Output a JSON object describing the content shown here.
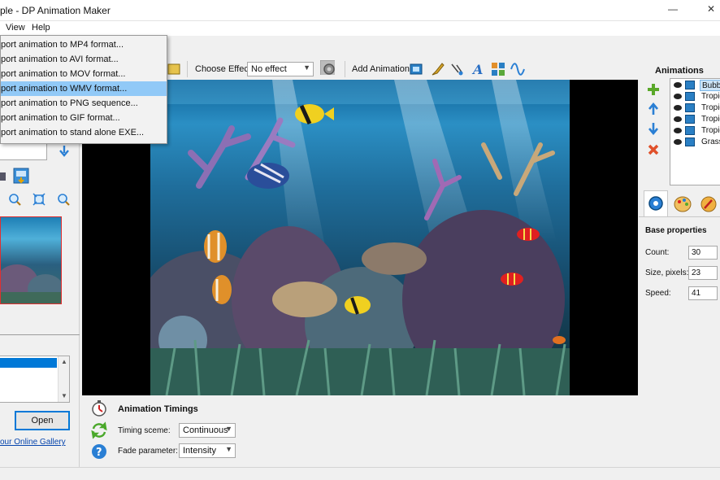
{
  "window": {
    "title": "ple - DP Animation Maker",
    "minimize": "—",
    "close": "✕"
  },
  "menu": {
    "items": [
      "View",
      "Help"
    ]
  },
  "export_menu": {
    "items": [
      "port animation to MP4 format...",
      "port animation to AVI format...",
      "port animation to MOV format...",
      "port animation to WMV format...",
      "port animation to PNG sequence...",
      "port animation to GIF format...",
      "port animation to stand alone EXE..."
    ],
    "selected_index": 3
  },
  "toolbar": {
    "choose_effect_label": "Choose Effect:",
    "effect_value": "No effect",
    "add_animation_label": "Add Animation"
  },
  "left": {
    "open_label": "Open",
    "gallery_link": "our Online Gallery"
  },
  "timing": {
    "title": "Animation Timings",
    "timing_scheme_label": "Timing sceme:",
    "timing_scheme_value": "Continuous",
    "fade_label": "Fade parameter:",
    "fade_value": "Intensity"
  },
  "animations": {
    "title": "Animations",
    "rows": [
      "Bubble",
      "Tropic",
      "Tropic",
      "Tropic",
      "Tropic",
      "Grass"
    ],
    "selected_index": 0
  },
  "properties": {
    "title": "Base properties",
    "count_label": "Count:",
    "count_value": "30",
    "size_label": "Size, pixels:",
    "size_value": "23",
    "speed_label": "Speed:",
    "speed_value": "41"
  },
  "colors": {
    "accent": "#0078d7",
    "selection": "#91c9f7",
    "thumb_border": "#e03030"
  }
}
